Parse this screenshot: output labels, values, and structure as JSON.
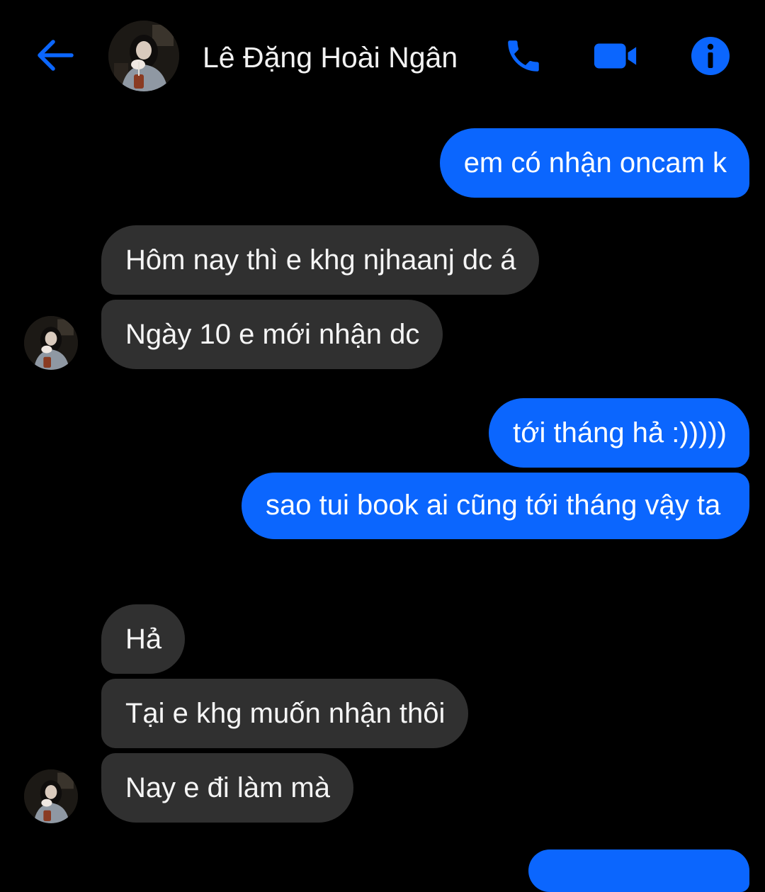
{
  "header": {
    "contact_name": "Lê Đặng Hoài Ngân",
    "back_icon": "arrow-left-icon",
    "call_icon": "phone-icon",
    "video_icon": "video-camera-icon",
    "info_icon": "info-icon",
    "accent_color": "#0b66fe"
  },
  "messages": [
    {
      "from": "me",
      "text": "em có nhận oncam k"
    },
    {
      "from": "contact",
      "text": "Hôm nay thì e khg njhaanj dc á"
    },
    {
      "from": "contact",
      "text": "Ngày 10 e mới nhận dc"
    },
    {
      "from": "me",
      "text": "tới tháng hả :)))))"
    },
    {
      "from": "me",
      "text": "sao tui book ai cũng tới tháng vậy ta"
    },
    {
      "from": "contact",
      "text": "Hả"
    },
    {
      "from": "contact",
      "text": "Tại e khg muốn nhận thôi"
    },
    {
      "from": "contact",
      "text": "Nay e đi làm mà"
    }
  ],
  "colors": {
    "background": "#000000",
    "outgoing_bubble": "#0b66fe",
    "incoming_bubble": "#303030"
  }
}
